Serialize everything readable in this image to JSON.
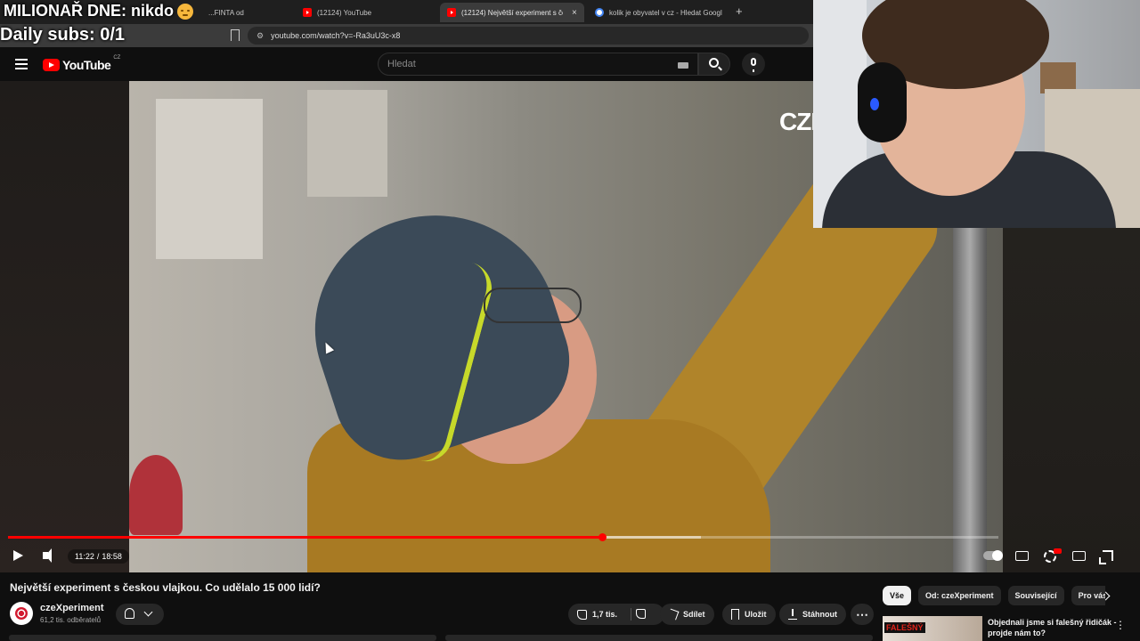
{
  "browser": {
    "tabs": [
      {
        "label": "...FINTA od",
        "icon": "youtube-favicon"
      },
      {
        "label": "(12124) YouTube",
        "icon": "youtube-favicon"
      },
      {
        "label": "(12124) Největší experiment s če",
        "icon": "youtube-favicon",
        "active": true
      },
      {
        "label": "kolik je obyvatel v cz - Hledat Googl",
        "icon": "google-favicon"
      }
    ],
    "new_tab": "+",
    "tab_close": "×",
    "url": "youtube.com/watch?v=-Ra3uU3c-x8"
  },
  "overlay": {
    "millionaire": "MILIONAŘ DNE: nikdo",
    "daily_subs": "Daily subs: 0/1"
  },
  "youtube": {
    "logo_text": "YouTube",
    "logo_country": "CZ",
    "search_placeholder": "Hledat"
  },
  "video": {
    "watermark": "CZE",
    "current_time": "11:22",
    "time_separator": "/",
    "duration": "18:58",
    "progress_fraction": 0.6,
    "buffered_fraction": 0.7,
    "progress_color": "#ff0000",
    "title": "Největší experiment s českou vlajkou. Co udělalo 15 000 lidí?"
  },
  "channel": {
    "name": "czeXperiment",
    "subscribers": "61,2 tis. odběratelů"
  },
  "actions": {
    "likes": "1,7 tis.",
    "share": "Sdílet",
    "save": "Uložit",
    "download": "Stáhnout",
    "more": "⋯"
  },
  "chips": [
    "Vše",
    "Od: czeXperiment",
    "Související",
    "Pro vás"
  ],
  "recommendation": {
    "thumb_label": "FALEŠNÝ",
    "title": "Objednali jsme si falešný řidičák - projde nám to?"
  }
}
